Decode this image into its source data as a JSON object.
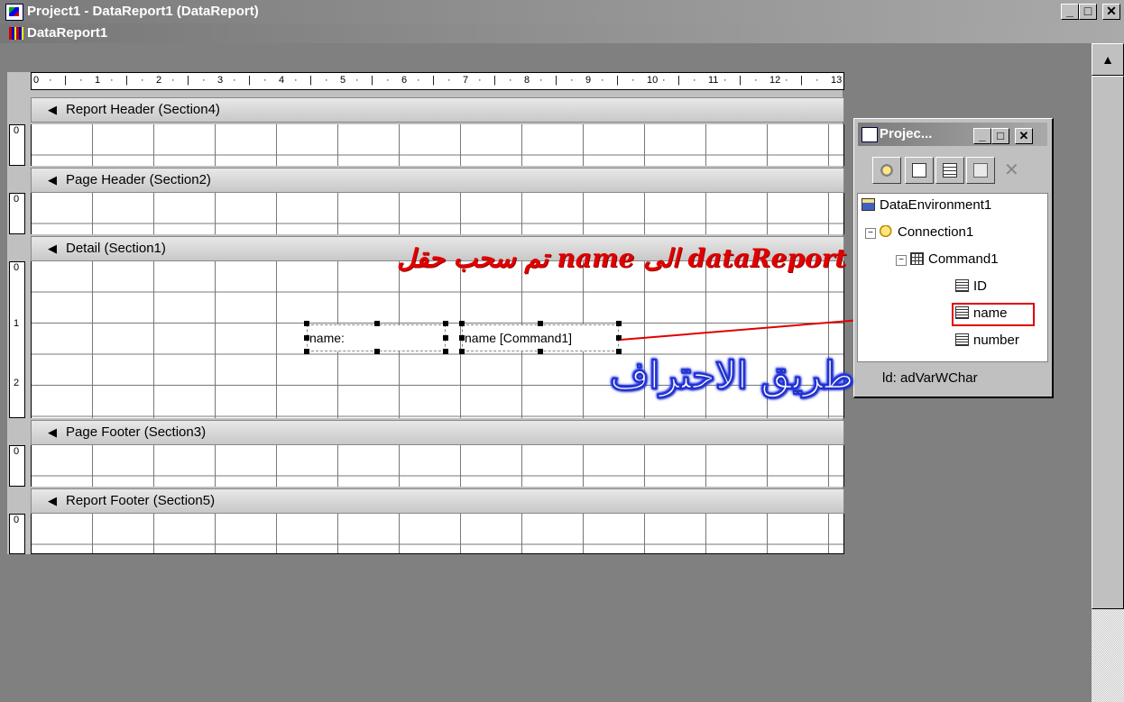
{
  "window": {
    "title": "Project1 - DataReport1 (DataReport)",
    "minimize": "_",
    "maximize": "□",
    "close": "✕"
  },
  "subwindow": {
    "title": "DataReport1",
    "scroll_up": "▲"
  },
  "ruler": {
    "marks": [
      "0",
      "1",
      "2",
      "3",
      "4",
      "5",
      "6",
      "7",
      "8",
      "9",
      "10",
      "11",
      "12",
      "13"
    ]
  },
  "sections": [
    {
      "label": "Report Header (Section4)",
      "vruler": [
        "0"
      ]
    },
    {
      "label": "Page Header (Section2)",
      "vruler": [
        "0"
      ]
    },
    {
      "label": "Detail (Section1)",
      "vruler": [
        "0",
        "1",
        "2"
      ]
    },
    {
      "label": "Page Footer (Section3)",
      "vruler": [
        "0"
      ]
    },
    {
      "label": "Report Footer (Section5)",
      "vruler": [
        "0"
      ]
    }
  ],
  "controls": {
    "label_text": "name:",
    "field_text": "name [Command1]"
  },
  "annotation": {
    "text": "تم سحب حقل name الى dataReport",
    "color": "#e00000"
  },
  "watermark": {
    "text": "طريق الاحتراف"
  },
  "project_window": {
    "title": "Projec...",
    "minimize": "_",
    "maximize": "□",
    "close": "✕",
    "tree": {
      "environment": "DataEnvironment1",
      "connection": "Connection1",
      "command": "Command1",
      "fields": [
        "ID",
        "name",
        "number"
      ],
      "selected_field": "name"
    },
    "status": "ld: adVarWChar"
  },
  "colors": {
    "title_gradient_start": "#7b7b7b",
    "title_gradient_end": "#a9a9a9",
    "workspace": "#808080",
    "highlight": "#e00000"
  }
}
